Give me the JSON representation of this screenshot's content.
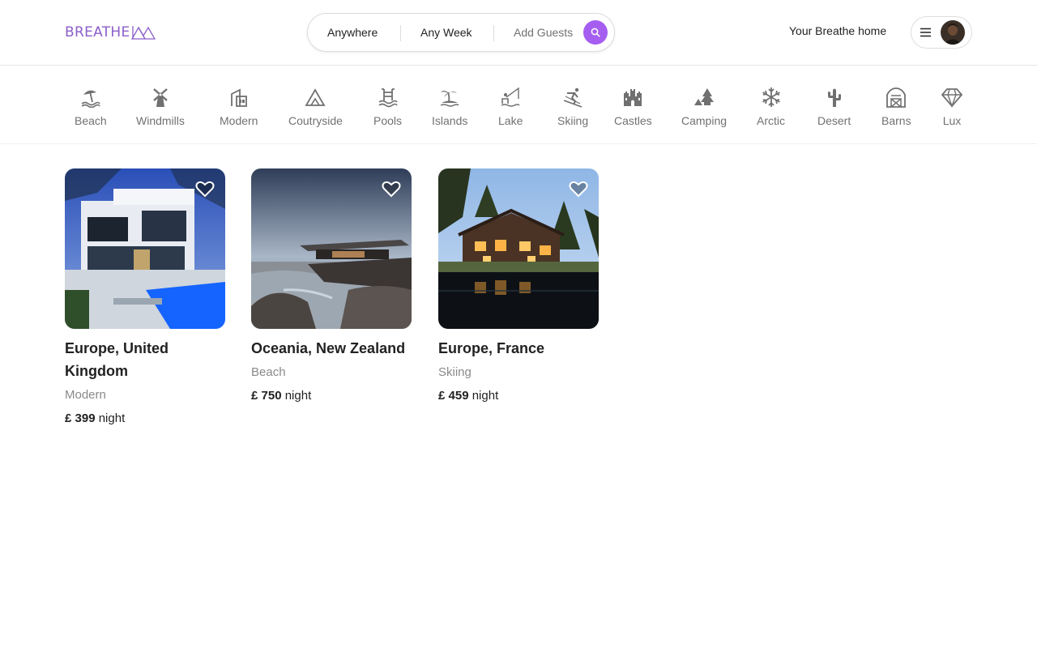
{
  "brand": {
    "name": "BREATHE",
    "accent": "#a55ef0",
    "logo_color": "#8b5fc9"
  },
  "search": {
    "where": "Anywhere",
    "when": "Any Week",
    "guests": "Add Guests"
  },
  "nav": {
    "host_link": "Your Breathe home"
  },
  "categories": [
    {
      "label": "Beach",
      "icon": "beach-umbrella-icon"
    },
    {
      "label": "Windmills",
      "icon": "windmill-icon"
    },
    {
      "label": "Modern",
      "icon": "modern-house-icon"
    },
    {
      "label": "Coutryside",
      "icon": "mountain-icon"
    },
    {
      "label": "Pools",
      "icon": "pool-icon"
    },
    {
      "label": "Islands",
      "icon": "island-palm-icon"
    },
    {
      "label": "Lake",
      "icon": "lake-fishing-icon"
    },
    {
      "label": "Skiing",
      "icon": "skier-icon"
    },
    {
      "label": "Castles",
      "icon": "castle-icon"
    },
    {
      "label": "Camping",
      "icon": "camping-tent-icon"
    },
    {
      "label": "Arctic",
      "icon": "snowflake-icon"
    },
    {
      "label": "Desert",
      "icon": "cactus-icon"
    },
    {
      "label": "Barns",
      "icon": "barn-icon"
    },
    {
      "label": "Lux",
      "icon": "diamond-icon"
    }
  ],
  "listings": [
    {
      "location": "Europe, United Kingdom",
      "category": "Modern",
      "currency": "£",
      "price": "399",
      "unit": "night"
    },
    {
      "location": "Oceania, New Zealand",
      "category": "Beach",
      "currency": "£",
      "price": "750",
      "unit": "night"
    },
    {
      "location": "Europe, France",
      "category": "Skiing",
      "currency": "£",
      "price": "459",
      "unit": "night"
    }
  ]
}
